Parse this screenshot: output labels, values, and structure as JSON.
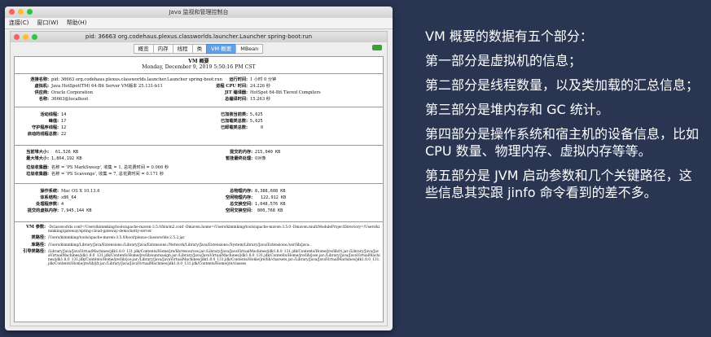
{
  "window": {
    "title": "Java 监视和管理控制台"
  },
  "menu": [
    "连接(C)",
    "窗口(W)",
    "帮助(H)"
  ],
  "inner": {
    "title": "pid: 36663 org.codehaus.plexus.classworlds.launcher.Launcher spring-boot:run"
  },
  "tabs": [
    "概览",
    "内存",
    "线程",
    "类",
    "VM 概要",
    "MBean"
  ],
  "active_tab": 4,
  "header": {
    "title": "VM 概要",
    "datetime": "Monday, December 9, 2019 5:50:16 PM CST"
  },
  "s1_left": [
    {
      "label": "连接名称:",
      "value": "pid: 36663 org.codehaus.plexus.classworlds.launcher.Launcher spring-boot:run"
    },
    {
      "label": "虚拟机:",
      "value": "Java HotSpot(TM) 64-Bit Server VM版本 25.131-b11"
    },
    {
      "label": "供应商:",
      "value": "Oracle Corporation"
    },
    {
      "label": "名称:",
      "value": "36663@localhost"
    }
  ],
  "s1_right": [
    {
      "label": "运行时间:",
      "value": "1 小时 0 分钟"
    },
    {
      "label": "进程 CPU 时间:",
      "value": "24.226 秒"
    },
    {
      "label": "JIT 编译器:",
      "value": "HotSpot 64-Bit Tiered Compilers"
    },
    {
      "label": "总编译时间:",
      "value": "15.263 秒"
    }
  ],
  "s2_left": [
    {
      "label": "活动线程:",
      "value": "14"
    },
    {
      "label": "峰值:",
      "value": "17"
    },
    {
      "label": "守护程序线程:",
      "value": "12"
    },
    {
      "label": "启动的线程总数:",
      "value": "22"
    }
  ],
  "s2_right": [
    {
      "label": "已加装当前类:",
      "value": "5,625"
    },
    {
      "label": "已加载类总数:",
      "value": "5,625"
    },
    {
      "label": "已卸载类总数:",
      "value": "0"
    }
  ],
  "s3_left": [
    {
      "label": "当前堆大小:",
      "value": "61,526 KB"
    },
    {
      "label": "最大堆大小:",
      "value": "1,864,192 KB"
    }
  ],
  "s3_right": [
    {
      "label": "提交的内存:",
      "value": "215,040 KB"
    },
    {
      "label": "暂挂最终处理:",
      "value": "0对象"
    }
  ],
  "s3_gc": [
    {
      "label": "垃圾收集器:",
      "value": "名称 = 'PS MarkSweep', 收集 = 1, 总花费时间 = 0.066 秒"
    },
    {
      "label": "垃圾收集器:",
      "value": "名称 = 'PS Scavenge', 收集 = 7, 总花费时间 = 0.171 秒"
    }
  ],
  "s4_left": [
    {
      "label": "操作系统:",
      "value": "Mac OS X 10.13.6"
    },
    {
      "label": "体系结构:",
      "value": "x86_64"
    },
    {
      "label": "处理程序数:",
      "value": "4"
    },
    {
      "label": "提交的虚拟内存:",
      "value": "7,945,144 KB"
    }
  ],
  "s4_right": [
    {
      "label": "总物理内存:",
      "value": "8,388,608 KB"
    },
    {
      "label": "空闲物理内存:",
      "value": "122,912 KB"
    },
    {
      "label": "总交换空间:",
      "value": "1,048,576 KB"
    },
    {
      "label": "空闲交换空间:",
      "value": "800,768 KB"
    }
  ],
  "s5": [
    {
      "label": "VM 参数:",
      "value": "-Dclassworlds.conf=/Users/kimmking/tools/apache-maven-3.5.0/bin/m2.conf -Dmaven.home=/Users/kimmking/tools/apache-maven-3.5.0 -Dmaven.multiModuleProjectDirectory=/Users/kimmking/gateway/spring-cloud-gateway-demo/netty-server"
    },
    {
      "label": "类路径:",
      "value": "/Users/kimmking/tools/apache-maven-3.5.0/boot/plexus-classworlds-2.5.2.jar"
    },
    {
      "label": "库路径:",
      "value": "/Users/kimmking/Library/Java/Extensions:/Library/Java/Extensions:/Network/Library/Java/Extensions:/System/Library/Java/Extensions:/usr/lib/java:."
    },
    {
      "label": "引导类路径:",
      "value": "/Library/Java/JavaVirtualMachines/jdk1.8.0_131.jdk/Contents/Home/jre/lib/resources.jar:/Library/Java/JavaVirtualMachines/jdk1.8.0_131.jdk/Contents/Home/jre/lib/rt.jar:/Library/Java/JavaVirtualMachines/jdk1.8.0_131.jdk/Contents/Home/jre/lib/sunrsasign.jar:/Library/Java/JavaVirtualMachines/jdk1.8.0_131.jdk/Contents/Home/jre/lib/jsse.jar:/Library/Java/JavaVirtualMachines/jdk1.8.0_131.jdk/Contents/Home/jre/lib/jce.jar:/Library/Java/JavaVirtualMachines/jdk1.8.0_131.jdk/Contents/Home/jre/lib/charsets.jar:/Library/Java/JavaVirtualMachines/jdk1.8.0_131.jdk/Contents/Home/jre/lib/jfr.jar:/Library/Java/JavaVirtualMachines/jdk1.8.0_131.jdk/Contents/Home/jre/classes"
    }
  ],
  "side_notes": [
    "VM 概要的数据有五个部分：",
    "第一部分是虚拟机的信息；",
    "第二部分是线程数量，以及类加载的汇总信息；",
    "第三部分是堆内存和 GC 统计。",
    "第四部分是操作系统和宿主机的设备信息，比如 CPU 数量、物理内存、虚拟内存等等。",
    "第五部分是 JVM 启动参数和几个关键路径，这些信息其实跟 jinfo 命令看到的差不多。"
  ]
}
